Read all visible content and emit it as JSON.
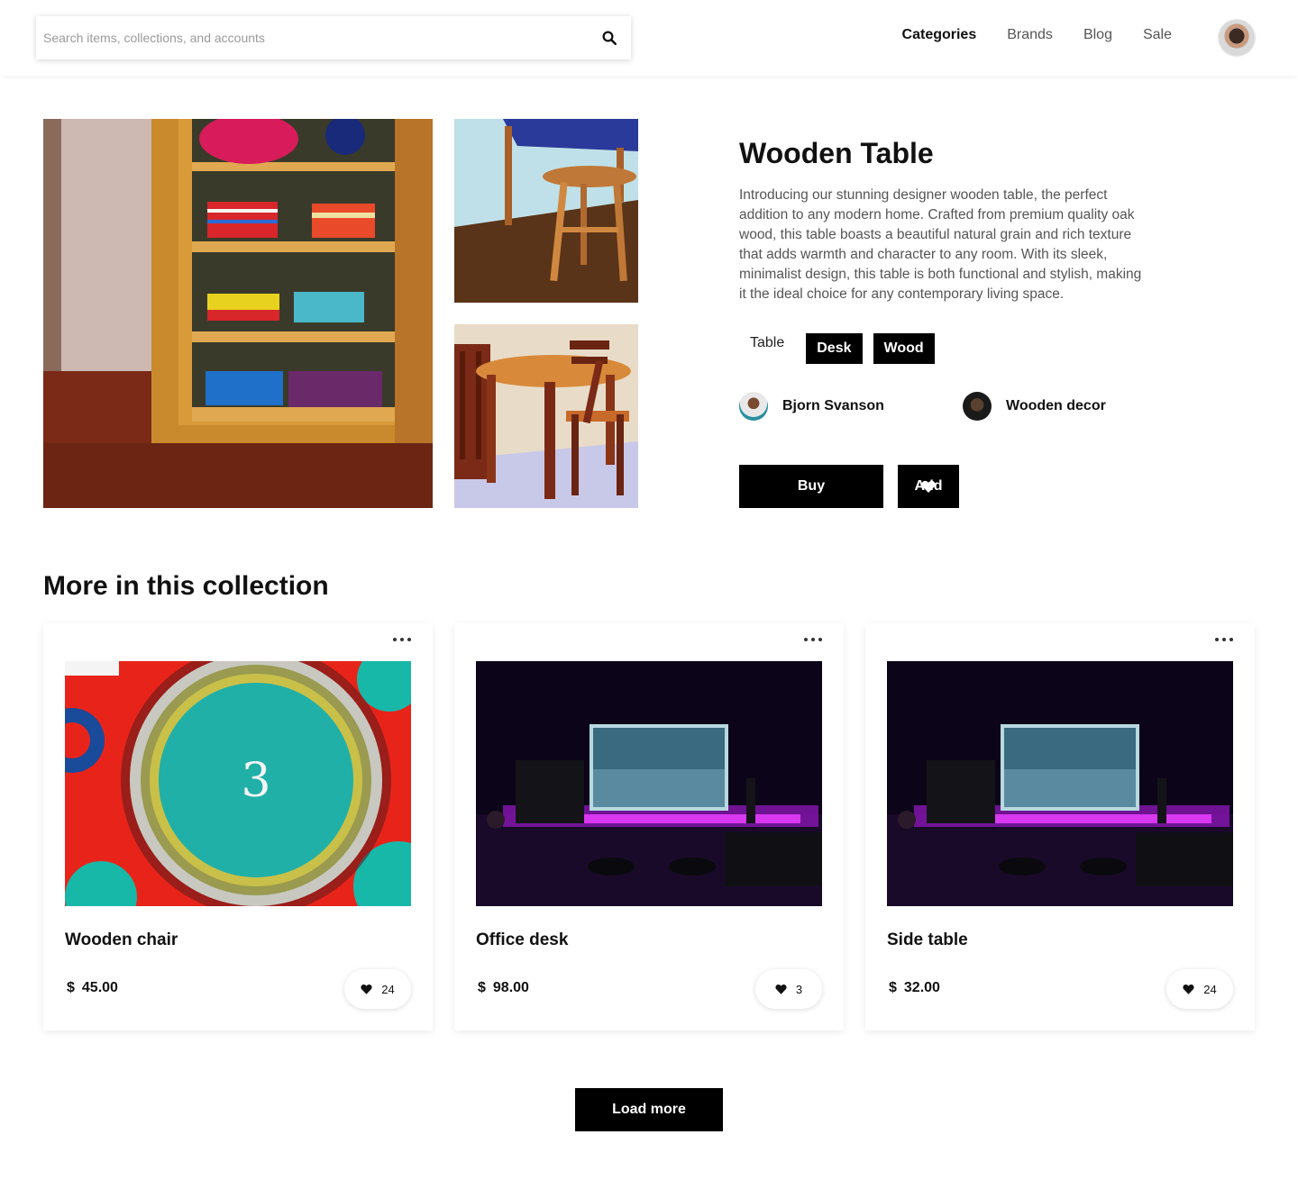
{
  "search": {
    "placeholder": "Search items, collections, and accounts"
  },
  "nav": {
    "items": [
      "Categories",
      "Brands",
      "Blog",
      "Sale"
    ],
    "active": "Categories"
  },
  "product": {
    "title": "Wooden Table",
    "description": "Introducing our stunning designer wooden table, the perfect addition to any modern home. Crafted from premium quality oak wood, this table boasts a beautiful natural grain and rich texture that adds warmth and character to any room. With its sleek, minimalist design, this table is both functional and stylish, making it the ideal choice for any contemporary living space.",
    "tags": [
      "Table",
      "Desk",
      "Wood"
    ],
    "creator": "Bjorn Svanson",
    "collection": "Wooden decor",
    "buy_label": "Buy",
    "add_label": "Add"
  },
  "collection": {
    "title": "More in this collection",
    "items": [
      {
        "name": "Wooden chair",
        "currency": "$",
        "price": "45.00",
        "likes": "24"
      },
      {
        "name": "Office desk",
        "currency": "$",
        "price": "98.00",
        "likes": "3"
      },
      {
        "name": "Side table",
        "currency": "$",
        "price": "32.00",
        "likes": "24"
      }
    ],
    "load_more_label": "Load more"
  },
  "icons": {
    "search": "search-icon",
    "heart": "heart-icon",
    "more": "more-dots-icon"
  }
}
